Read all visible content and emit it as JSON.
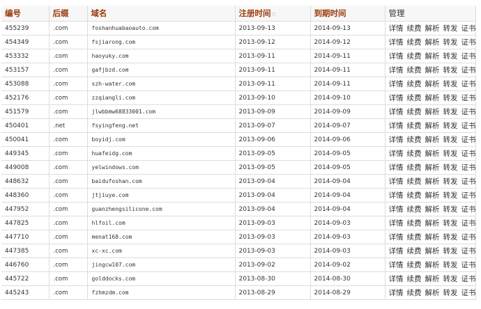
{
  "headers": {
    "id": "编号",
    "suffix": "后缀",
    "domain": "域名",
    "reg_date": "注册时间",
    "sort_indicator": "▽",
    "exp_date": "到期时间",
    "manage": "管理"
  },
  "actions": [
    "详情",
    "续费",
    "解析",
    "转发",
    "证书"
  ],
  "rows": [
    {
      "id": "455239",
      "ext": ".com",
      "domain": "foshanhuabaoauto.com",
      "reg": "2013-09-13",
      "exp": "2014-09-13"
    },
    {
      "id": "454349",
      "ext": ".com",
      "domain": "fsjiarong.com",
      "reg": "2013-09-12",
      "exp": "2014-09-12"
    },
    {
      "id": "453332",
      "ext": ".com",
      "domain": "haoyuky.com",
      "reg": "2013-09-11",
      "exp": "2014-09-11"
    },
    {
      "id": "453157",
      "ext": ".com",
      "domain": "gafjbzd.com",
      "reg": "2013-09-11",
      "exp": "2014-09-11"
    },
    {
      "id": "453088",
      "ext": ".com",
      "domain": "szh-water.com",
      "reg": "2013-09-11",
      "exp": "2014-09-11"
    },
    {
      "id": "452176",
      "ext": ".com",
      "domain": "zzqiangli.com",
      "reg": "2013-09-10",
      "exp": "2014-09-10"
    },
    {
      "id": "451579",
      "ext": ".com",
      "domain": "jlwbbmw68833001.com",
      "reg": "2013-09-09",
      "exp": "2014-09-09"
    },
    {
      "id": "450401",
      "ext": ".net",
      "domain": "fsyingfeng.net",
      "reg": "2013-09-07",
      "exp": "2014-09-07"
    },
    {
      "id": "450041",
      "ext": ".com",
      "domain": "boyidj.com",
      "reg": "2013-09-06",
      "exp": "2014-09-06"
    },
    {
      "id": "449345",
      "ext": ".com",
      "domain": "huafeidg.com",
      "reg": "2013-09-05",
      "exp": "2014-09-05"
    },
    {
      "id": "449008",
      "ext": ".com",
      "domain": "yelwindows.com",
      "reg": "2013-09-05",
      "exp": "2014-09-05"
    },
    {
      "id": "448632",
      "ext": ".com",
      "domain": "baidufoshan.com",
      "reg": "2013-09-04",
      "exp": "2014-09-04"
    },
    {
      "id": "448360",
      "ext": ".com",
      "domain": "jtjiuye.com",
      "reg": "2013-09-04",
      "exp": "2014-09-04"
    },
    {
      "id": "447952",
      "ext": ".com",
      "domain": "guanzhengsilicone.com",
      "reg": "2013-09-04",
      "exp": "2014-09-04"
    },
    {
      "id": "447825",
      "ext": ".com",
      "domain": "hlfoil.com",
      "reg": "2013-09-03",
      "exp": "2014-09-03"
    },
    {
      "id": "447710",
      "ext": ".com",
      "domain": "menat168.com",
      "reg": "2013-09-03",
      "exp": "2014-09-03"
    },
    {
      "id": "447385",
      "ext": ".com",
      "domain": "xc-xc.com",
      "reg": "2013-09-03",
      "exp": "2014-09-03"
    },
    {
      "id": "446760",
      "ext": ".com",
      "domain": "jingcw107.com",
      "reg": "2013-09-02",
      "exp": "2014-09-02"
    },
    {
      "id": "445722",
      "ext": ".com",
      "domain": "golddocks.com",
      "reg": "2013-08-30",
      "exp": "2014-08-30"
    },
    {
      "id": "445243",
      "ext": ".com",
      "domain": "fzhmzdm.com",
      "reg": "2013-08-29",
      "exp": "2014-08-29"
    }
  ]
}
